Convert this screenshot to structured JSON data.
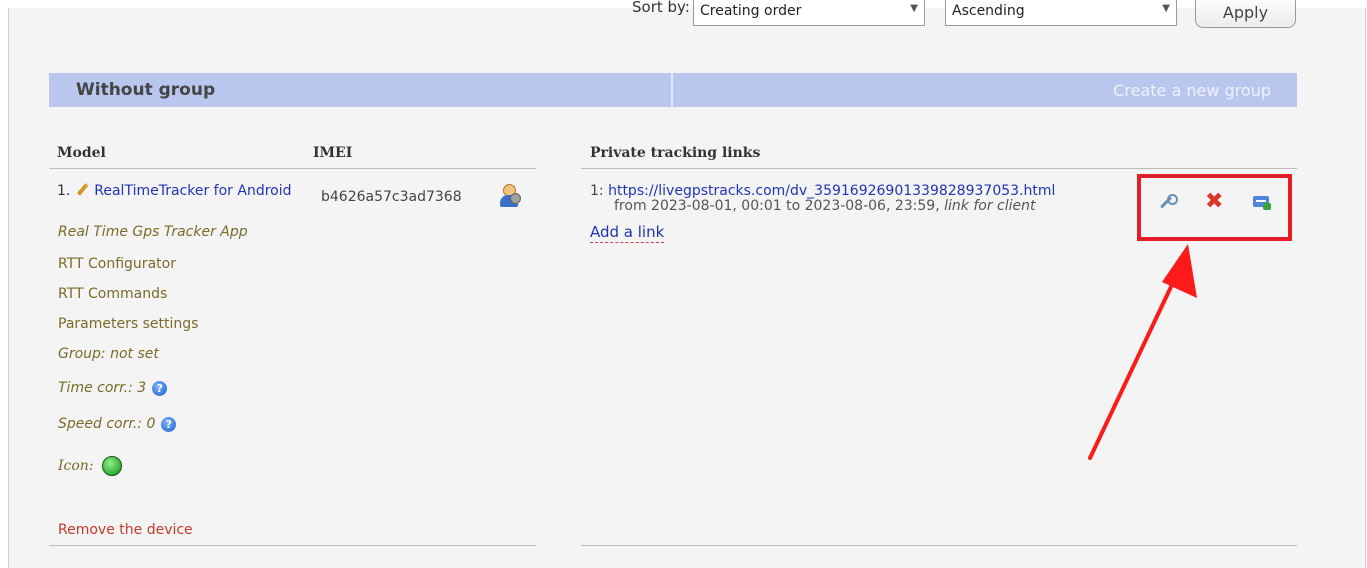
{
  "toolbar": {
    "sort_label": "Sort by:",
    "sort_value": "Creating order",
    "order_value": "Ascending",
    "apply_label": "Apply"
  },
  "group": {
    "title": "Without group",
    "create_label": "Create a new group"
  },
  "columns": {
    "model": "Model",
    "imei": "IMEI",
    "tracking_links": "Private tracking links"
  },
  "device": {
    "index": "1.",
    "name": "RealTimeTracker for Android",
    "items": [
      "Real Time Gps Tracker App",
      "RTT Configurator",
      "RTT Commands",
      "Parameters settings",
      "Group: not set"
    ],
    "time_corr": "Time corr.: 3",
    "speed_corr": "Speed corr.: 0",
    "icon_label": "Icon:",
    "remove_label": "Remove the device",
    "imei": "b4626a57c3ad7368"
  },
  "tracking_link": {
    "index": "1:",
    "url": "https://livegpstracks.com/dv_3591692690133982893705 3.html",
    "url_text": "https://livegpstracks.com/dv_35916926901339828937053.html",
    "range": "from 2023-08-01, 00:01 to 2023-08-06, 23:59,",
    "note": "link for client",
    "add_label": "Add a link"
  },
  "icons": {
    "edit": "pencil-icon",
    "user": "user-key-icon",
    "help": "help-icon",
    "status": "green-dot-icon",
    "wrench": "wrench-icon",
    "delete": "delete-icon",
    "card": "card-icon"
  },
  "colors": {
    "group_bar": "#b9c7ee",
    "link": "#2233bb",
    "highlight": "#e31e24"
  }
}
